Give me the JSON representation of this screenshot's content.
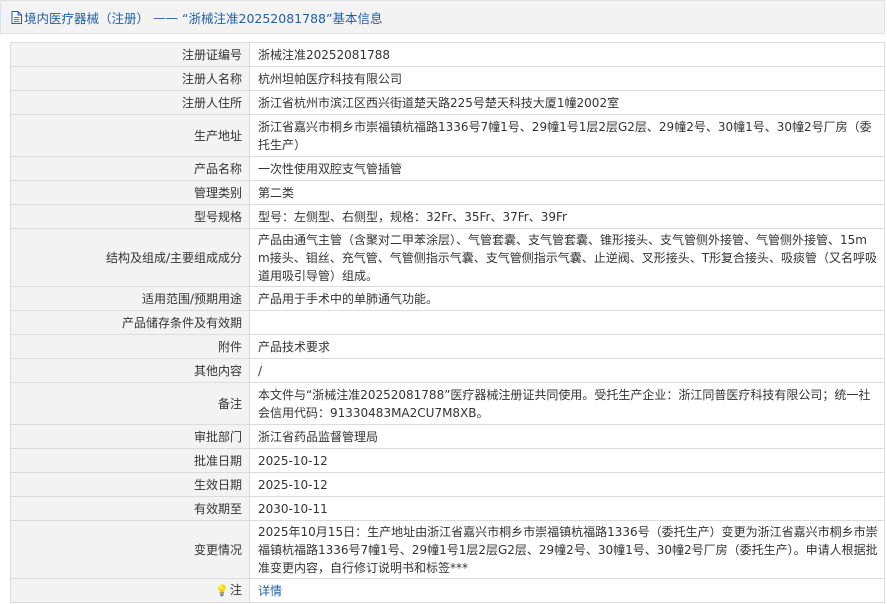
{
  "header": {
    "category": "境内医疗器械（注册）",
    "separator": "——",
    "title": "“浙械注准20252081788”基本信息"
  },
  "rows": [
    {
      "label": "注册证编号",
      "value": "浙械注准20252081788"
    },
    {
      "label": "注册人名称",
      "value": "杭州坦帕医疗科技有限公司"
    },
    {
      "label": "注册人住所",
      "value": "浙江省杭州市滨江区西兴街道楚天路225号楚天科技大厦1幢2002室"
    },
    {
      "label": "生产地址",
      "value": "浙江省嘉兴市桐乡市崇福镇杭福路1336号7幢1号、29幢1号1层2层G2层、29幢2号、30幢1号、30幢2号厂房（委托生产）"
    },
    {
      "label": "产品名称",
      "value": "一次性使用双腔支气管插管"
    },
    {
      "label": "管理类别",
      "value": "第二类"
    },
    {
      "label": "型号规格",
      "value": "型号：左侧型、右侧型，规格：32Fr、35Fr、37Fr、39Fr"
    },
    {
      "label": "结构及组成/主要组成成分",
      "value": "产品由通气主管（含聚对二甲苯涂层）、气管套囊、支气管套囊、锥形接头、支气管侧外接管、气管侧外接管、15mm接头、钼丝、充气管、气管侧指示气囊、支气管侧指示气囊、止逆阀、叉形接头、T形复合接头、吸痰管（又名呼吸道用吸引导管）组成。"
    },
    {
      "label": "适用范围/预期用途",
      "value": "产品用于手术中的单肺通气功能。"
    },
    {
      "label": "产品储存条件及有效期",
      "value": ""
    },
    {
      "label": "附件",
      "value": "产品技术要求"
    },
    {
      "label": "其他内容",
      "value": "/"
    },
    {
      "label": "备注",
      "value": "本文件与“浙械注准20252081788”医疗器械注册证共同使用。受托生产企业：浙江同普医疗科技有限公司；统一社会信用代码：91330483MA2CU7M8XB。"
    },
    {
      "label": "审批部门",
      "value": "浙江省药品监督管理局"
    },
    {
      "label": "批准日期",
      "value": "2025-10-12"
    },
    {
      "label": "生效日期",
      "value": "2025-10-12"
    },
    {
      "label": "有效期至",
      "value": "2030-10-11"
    },
    {
      "label": "变更情况",
      "value": "2025年10月15日：生产地址由浙江省嘉兴市桐乡市崇福镇杭福路1336号（委托生产）变更为浙江省嘉兴市桐乡市崇福镇杭福路1336号7幢1号、29幢1号1层2层G2层、29幢2号、30幢1号、30幢2号厂房（委托生产）。申请人根据批准变更内容，自行修订说明书和标签***"
    }
  ],
  "note": {
    "label": "注",
    "link": "详情"
  }
}
